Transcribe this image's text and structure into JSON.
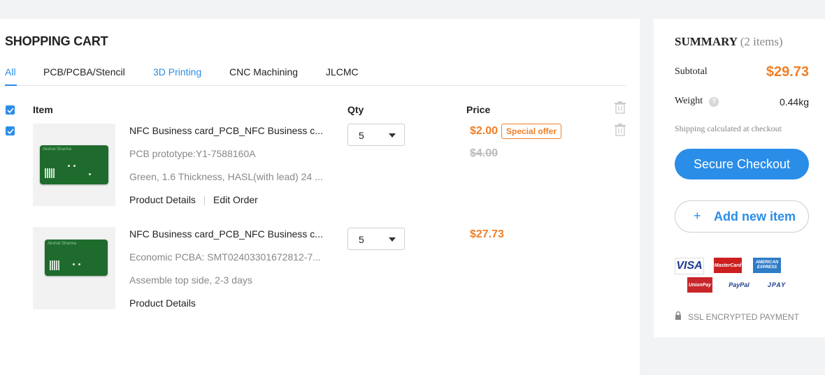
{
  "cart": {
    "title": "SHOPPING CART",
    "tabs": [
      {
        "label": "All"
      },
      {
        "label": "PCB/PCBA/Stencil"
      },
      {
        "label": "3D Printing"
      },
      {
        "label": "CNC Machining"
      },
      {
        "label": "JLCMC"
      }
    ],
    "headers": {
      "item": "Item",
      "qty": "Qty",
      "price": "Price"
    },
    "items": [
      {
        "pcb_label": "Akshat Sharma",
        "title": "NFC Business card_PCB_NFC Business c...",
        "meta1": "PCB prototype:Y1-7588160A",
        "meta2": "Green, 1.6 Thickness, HASL(with lead) 24 ...",
        "link1": "Product Details",
        "link2": "Edit Order",
        "qty": "5",
        "price": "$2.00",
        "badge": "Special offer",
        "old_price": "$4.00",
        "checked": true
      },
      {
        "pcb_label": "Akshat Sharma",
        "title": "NFC Business card_PCB_NFC Business c...",
        "meta1": "Economic PCBA: SMT02403301672812-7...",
        "meta2": "Assemble top side, 2-3 days",
        "link1": "Product Details",
        "qty": "5",
        "price": "$27.73"
      }
    ]
  },
  "summary": {
    "title": "SUMMARY",
    "count": "(2 items)",
    "subtotal_label": "Subtotal",
    "subtotal_value": "$29.73",
    "weight_label": "Weight",
    "weight_value": "0.44kg",
    "help_icon": "?",
    "shipping_note": "Shipping calculated at checkout",
    "checkout_label": "Secure Checkout",
    "add_plus": "+",
    "add_label": "Add new item",
    "ssl_label": "SSL ENCRYPTED PAYMENT"
  },
  "payment_icons": [
    {
      "name": "visa-icon",
      "text": "VISA"
    },
    {
      "name": "mastercard-icon",
      "text": "MasterCard"
    },
    {
      "name": "amex-icon",
      "text": "AMERICAN EXPRESS"
    },
    {
      "name": "unionpay-icon",
      "text": "UnionPay"
    },
    {
      "name": "paypal-icon",
      "text": "PayPal"
    },
    {
      "name": "jcb-icon",
      "text": "JPAY"
    }
  ],
  "colors": {
    "accent": "#2a8de8",
    "price": "#f07f28",
    "muted": "#888888",
    "pcb_green": "#1f6b2d"
  }
}
